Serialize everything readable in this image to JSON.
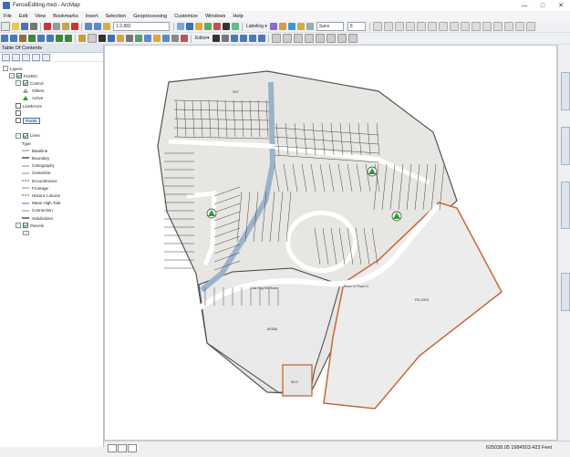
{
  "window": {
    "title": "FenceEditing.mxd - ArcMap"
  },
  "menus": [
    "File",
    "Edit",
    "View",
    "Bookmarks",
    "Insert",
    "Selection",
    "Geoprocessing",
    "Customize",
    "Windows",
    "Help"
  ],
  "toolbar1": {
    "scale": "1:2,882",
    "labeling": "Labeling ▾",
    "font_size": "8",
    "font": "Sans"
  },
  "toolbar2": {
    "editor": "Editor▾"
  },
  "toc": {
    "title": "Table Of Contents",
    "items": [
      {
        "label": "Layers",
        "indent": 0,
        "symbol": "group"
      },
      {
        "label": "FLMSC",
        "indent": 1,
        "symbol": "group",
        "checked": true
      },
      {
        "label": "Control",
        "indent": 2,
        "symbol": "group",
        "checked": true
      },
      {
        "label": "Others",
        "indent": 3,
        "symbol": "point-gray"
      },
      {
        "label": "Active",
        "indent": 3,
        "symbol": "point-green"
      },
      {
        "label": "LineErrors",
        "indent": 2,
        "symbol": "none",
        "checked": false
      },
      {
        "label": "",
        "indent": 2,
        "symbol": "none",
        "checked": false
      },
      {
        "label": "Points",
        "indent": 2,
        "symbol": "none",
        "checked": false,
        "selected": true
      },
      {
        "label": "",
        "indent": 3,
        "symbol": "none"
      },
      {
        "label": "Lines",
        "indent": 2,
        "symbol": "group",
        "checked": true
      },
      {
        "label": "Type",
        "indent": 3,
        "symbol": "none"
      },
      {
        "label": "Baseline",
        "indent": 3,
        "symbol": "line-gray"
      },
      {
        "label": "Boundary",
        "indent": 3,
        "symbol": "line-black"
      },
      {
        "label": "Cartography",
        "indent": 3,
        "symbol": "line-gray"
      },
      {
        "label": "Centerline",
        "indent": 3,
        "symbol": "line-gray"
      },
      {
        "label": "Encumbrance",
        "indent": 3,
        "symbol": "line-dash"
      },
      {
        "label": "Frontage",
        "indent": 3,
        "symbol": "line-gray"
      },
      {
        "label": "Historic LotLine",
        "indent": 3,
        "symbol": "line-dash"
      },
      {
        "label": "Mean High Tide",
        "indent": 3,
        "symbol": "line-blue"
      },
      {
        "label": "Connection",
        "indent": 3,
        "symbol": "line-gray"
      },
      {
        "label": "Subdivision",
        "indent": 3,
        "symbol": "line-black"
      },
      {
        "label": "Parcels",
        "indent": 2,
        "symbol": "group",
        "checked": true
      },
      {
        "label": "",
        "indent": 3,
        "symbol": "parcel"
      }
    ]
  },
  "map": {
    "labels": {
      "north": "397",
      "large_left": "89355",
      "large_right": "R9.2003",
      "bottom_small": "55.0",
      "road_label": "Oak Rdg Hill Road",
      "road_label2": "Bison Ct Road Ct"
    }
  },
  "status": {
    "coords": "625038.05  1984503.423 Feet"
  },
  "colors": {
    "accent": "#c8663a",
    "parcel_fill": "#e9e9e9",
    "control_green": "#2aa02a"
  }
}
